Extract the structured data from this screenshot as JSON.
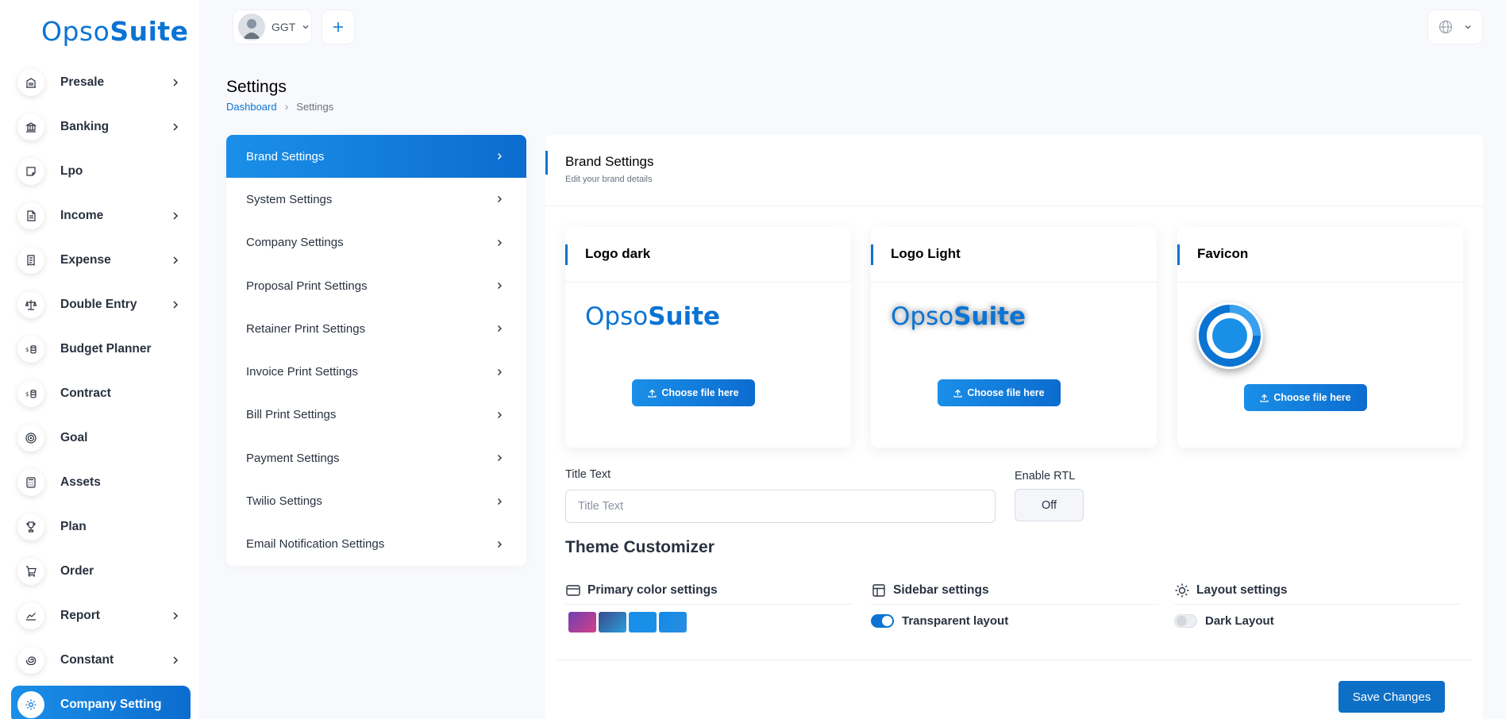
{
  "brand": {
    "logo_prefix": "Opso",
    "logo_suffix": "Suite",
    "accent_color": "#0b74d3"
  },
  "header": {
    "user_name": "GGT",
    "add_symbol": "+"
  },
  "sidebar": {
    "items": [
      {
        "label": "Presale",
        "icon": "building-icon",
        "has_arrow": true
      },
      {
        "label": "Banking",
        "icon": "bank-icon",
        "has_arrow": true
      },
      {
        "label": "Lpo",
        "icon": "sticky-note-icon",
        "has_arrow": false
      },
      {
        "label": "Income",
        "icon": "document-icon",
        "has_arrow": true
      },
      {
        "label": "Expense",
        "icon": "receipt-icon",
        "has_arrow": true
      },
      {
        "label": "Double Entry",
        "icon": "scale-icon",
        "has_arrow": true
      },
      {
        "label": "Budget Planner",
        "icon": "coins-icon",
        "has_arrow": false
      },
      {
        "label": "Contract",
        "icon": "coins-icon",
        "has_arrow": false
      },
      {
        "label": "Goal",
        "icon": "target-icon",
        "has_arrow": false
      },
      {
        "label": "Assets",
        "icon": "calculator-icon",
        "has_arrow": false
      },
      {
        "label": "Plan",
        "icon": "trophy-icon",
        "has_arrow": false
      },
      {
        "label": "Order",
        "icon": "cart-icon",
        "has_arrow": false
      },
      {
        "label": "Report",
        "icon": "chart-line-icon",
        "has_arrow": true
      },
      {
        "label": "Constant",
        "icon": "spiral-icon",
        "has_arrow": true
      },
      {
        "label": "Company Setting",
        "icon": "gear-icon",
        "has_arrow": false,
        "active": true
      }
    ]
  },
  "page": {
    "title": "Settings",
    "breadcrumb": {
      "home": "Dashboard",
      "current": "Settings"
    }
  },
  "settings_menu": {
    "items": [
      {
        "label": "Brand Settings",
        "active": true
      },
      {
        "label": "System Settings"
      },
      {
        "label": "Company Settings"
      },
      {
        "label": "Proposal Print Settings"
      },
      {
        "label": "Retainer Print Settings"
      },
      {
        "label": "Invoice Print Settings"
      },
      {
        "label": "Bill Print Settings"
      },
      {
        "label": "Payment Settings"
      },
      {
        "label": "Twilio Settings"
      },
      {
        "label": "Email Notification Settings"
      }
    ]
  },
  "brand_settings": {
    "title": "Brand Settings",
    "subtitle": "Edit your brand details",
    "logo_dark": {
      "title": "Logo dark",
      "button": "Choose file here"
    },
    "logo_light": {
      "title": "Logo Light",
      "button": "Choose file here"
    },
    "favicon": {
      "title": "Favicon",
      "button": "Choose file here"
    },
    "title_text": {
      "label": "Title Text",
      "placeholder": "Title Text",
      "value": ""
    },
    "enable_rtl": {
      "label": "Enable RTL",
      "value": "Off"
    },
    "theme_customizer": {
      "title": "Theme Customizer",
      "primary_color": {
        "title": "Primary color settings",
        "swatches": [
          "linear-gradient(135deg,#6f3fb0,#d4418a)",
          "linear-gradient(135deg,#3b4a8f,#2a9fd8)",
          "#1a8fe8",
          "linear-gradient(135deg,#0f8be6,#2c8ce0)"
        ]
      },
      "sidebar": {
        "title": "Sidebar settings",
        "toggle_label": "Transparent layout",
        "toggle_on": true
      },
      "layout": {
        "title": "Layout settings",
        "toggle_label": "Dark Layout",
        "toggle_on": false
      }
    },
    "save_label": "Save Changes"
  }
}
